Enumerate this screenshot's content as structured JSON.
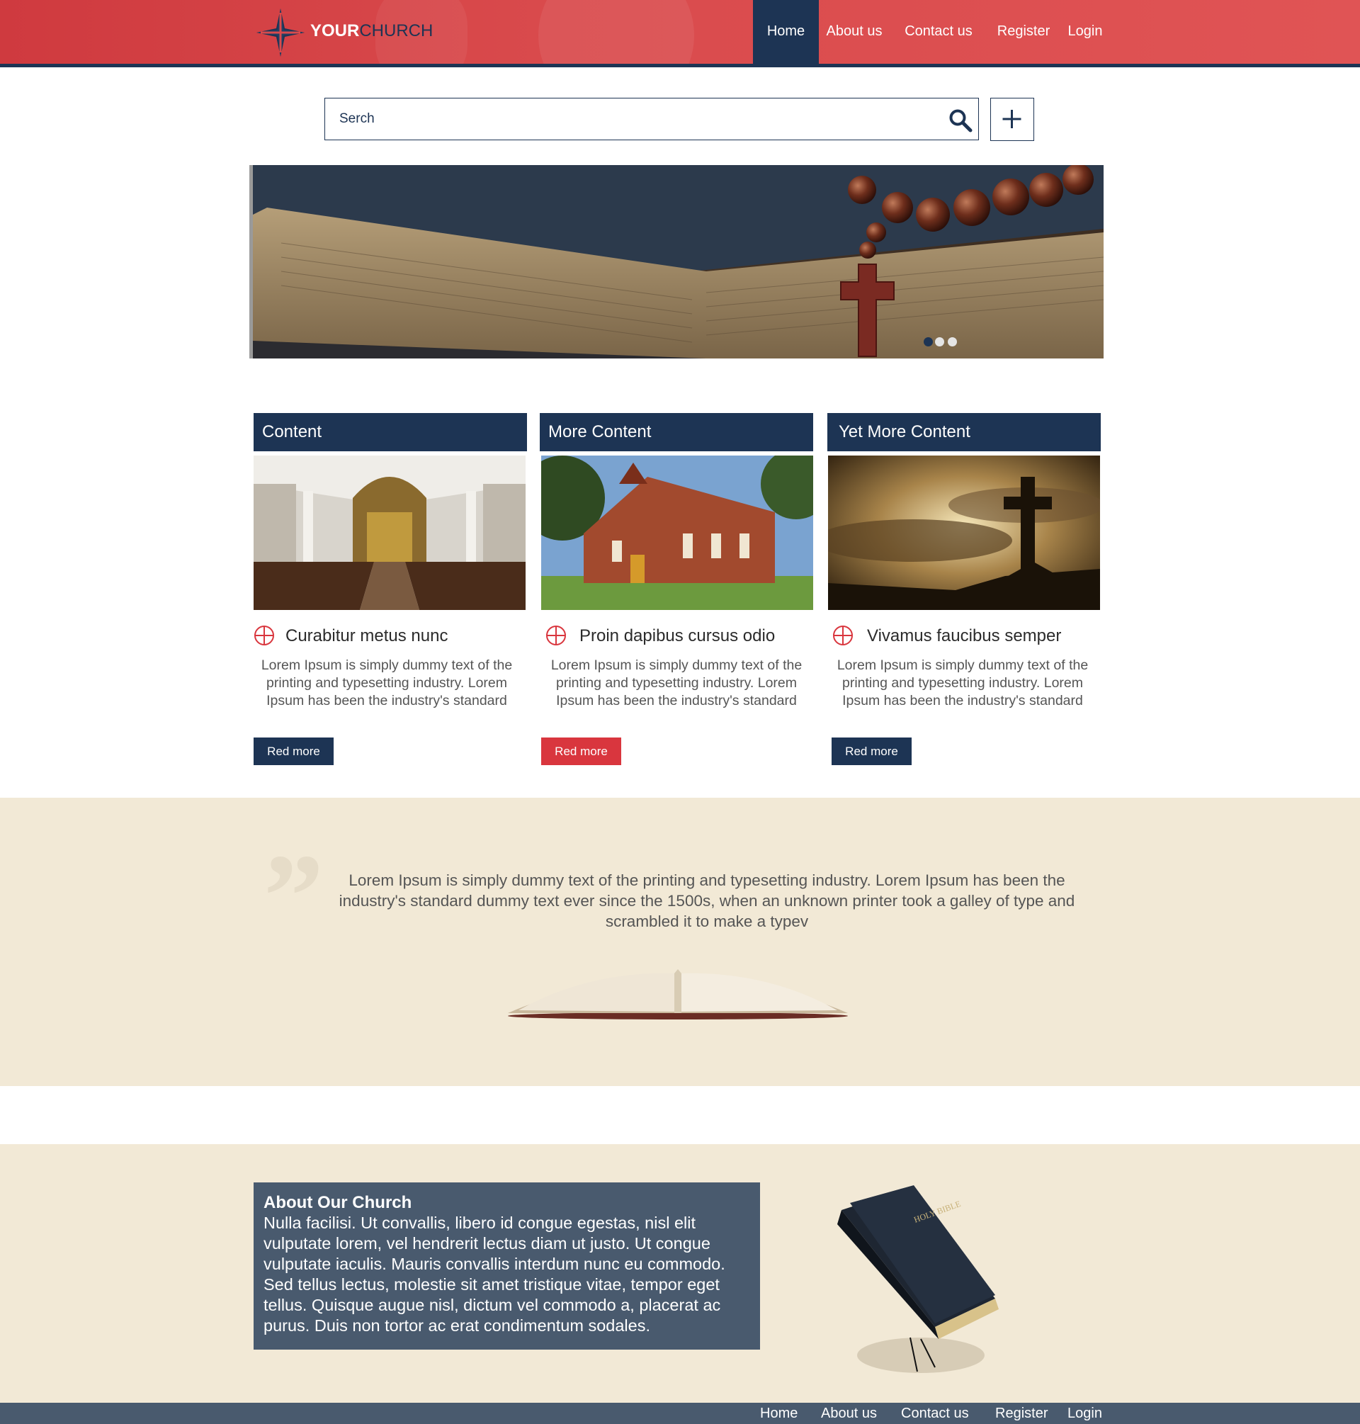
{
  "brand": {
    "name_part1": "YOUR",
    "name_part2": "CHURCH",
    "colors": {
      "red": "#d94a4c",
      "navy": "#1d3454",
      "slate": "#495a6e",
      "cream": "#f2e9d6"
    }
  },
  "nav": {
    "items": [
      {
        "label": "Home",
        "active": true
      },
      {
        "label": "About us",
        "active": false
      },
      {
        "label": "Contact us",
        "active": false
      },
      {
        "label": "Register",
        "active": false
      },
      {
        "label": "Login",
        "active": false
      }
    ]
  },
  "search": {
    "placeholder": "Serch",
    "icon": "search-icon",
    "add_icon": "plus-icon"
  },
  "hero": {
    "image": "bible-with-rosary-photo",
    "slides": 3,
    "active_slide": 1
  },
  "columns": [
    {
      "heading": "Content",
      "image": "cathedral-interior-photo",
      "title": "Curabitur metus nunc",
      "text": "Lorem Ipsum is simply dummy text of the printing and typesetting industry. Lorem Ipsum has been the industry's standard",
      "button": "Red more",
      "button_color": "#1d3454"
    },
    {
      "heading": "More Content",
      "image": "brick-church-photo",
      "title": "Proin dapibus cursus odio",
      "text": "Lorem Ipsum is simply dummy text of the printing and typesetting industry. Lorem Ipsum has been the industry's standard",
      "button": "Red more",
      "button_color": "#d9363e"
    },
    {
      "heading": "Yet More Content",
      "image": "cross-in-clouds-photo",
      "title": "Vivamus faucibus semper",
      "text": "Lorem Ipsum is simply dummy text of the printing and typesetting industry. Lorem Ipsum has been the industry's standard",
      "button": "Red more",
      "button_color": "#1d3454"
    }
  ],
  "quote": {
    "text": "Lorem Ipsum is simply dummy text of the printing and typesetting industry. Lorem Ipsum has been the industry's standard dummy text ever since the 1500s, when an unknown printer took a galley of type and scrambled it to make a typev",
    "mark": "”"
  },
  "about": {
    "title": "About Our Church",
    "text": "Nulla facilisi. Ut convallis, libero id congue egestas, nisl elit vulputate lorem, vel hendrerit lectus diam ut justo. Ut congue vulputate iaculis. Mauris convallis interdum nunc eu commodo. Sed tellus lectus, molestie sit amet tristique vitae, tempor eget tellus. Quisque augue nisl, dictum vel commodo a, placerat ac purus. Duis non tortor ac erat condimentum sodales.",
    "book_label": "HOLY BIBLE"
  },
  "footer_nav": {
    "items": [
      "Home",
      "About us",
      "Contact us",
      "Register",
      "Login"
    ]
  }
}
